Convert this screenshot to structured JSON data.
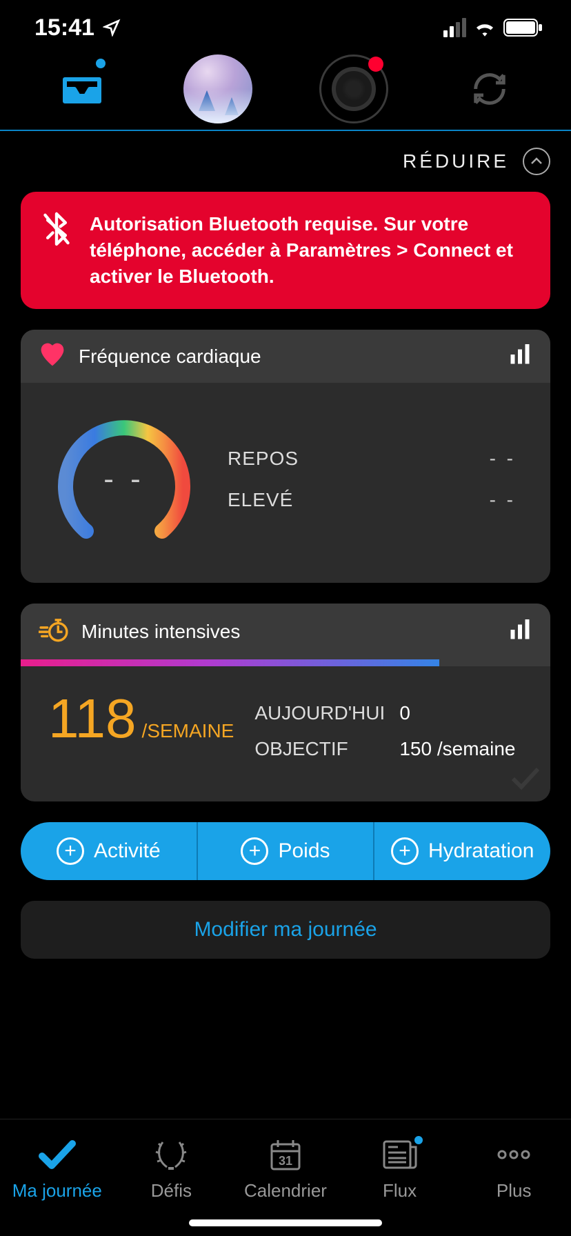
{
  "status": {
    "time": "15:41"
  },
  "reduce_label": "RÉDUIRE",
  "alert": {
    "text": "Autorisation Bluetooth requise. Sur votre téléphone, accéder à Paramètres > Connect et activer le Bluetooth."
  },
  "heart": {
    "title": "Fréquence cardiaque",
    "value": "- -",
    "rest_label": "REPOS",
    "rest_value": "- -",
    "high_label": "ELEVÉ",
    "high_value": "- -"
  },
  "intensive": {
    "title": "Minutes intensives",
    "value": "118",
    "unit": "/SEMAINE",
    "today_label": "AUJOURD'HUI",
    "today_value": "0",
    "goal_label": "OBJECTIF",
    "goal_value": "150 /semaine",
    "progress_pct": 79
  },
  "quick": {
    "activity": "Activité",
    "weight": "Poids",
    "hydration": "Hydratation"
  },
  "modify_label": "Modifier ma journée",
  "tabs": {
    "day": "Ma journée",
    "challenges": "Défis",
    "calendar": "Calendrier",
    "feed": "Flux",
    "more": "Plus"
  }
}
